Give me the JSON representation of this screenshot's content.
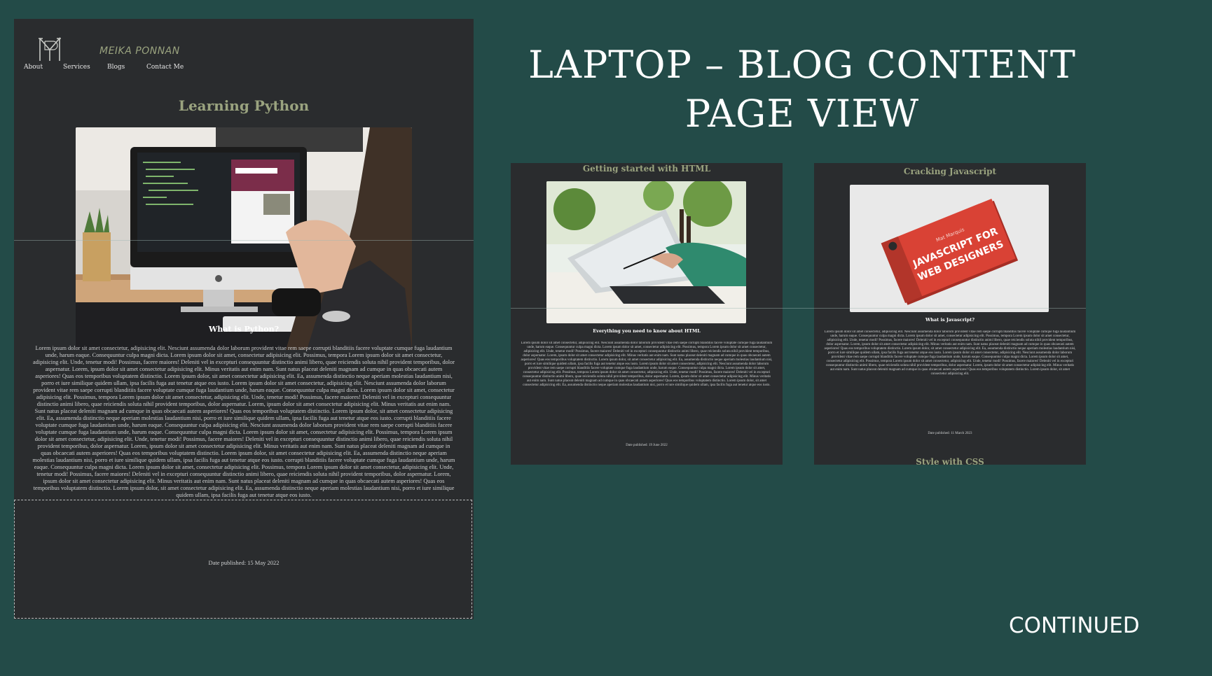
{
  "slide": {
    "title_line1": "LAPTOP – BLOG CONTENT",
    "title_line2": "PAGE VIEW",
    "continued": "CONTINUED"
  },
  "site": {
    "brand": "MEIKA PONNAN",
    "nav": [
      "About",
      "Services",
      "Blogs",
      "Contact Me"
    ]
  },
  "main_post": {
    "title": "Learning Python",
    "subheading": "What is Python?",
    "body": "Lorem ipsum dolor sit amet consectetur, adipisicing elit. Nesciunt assumenda dolor laborum provident vitae rem saepe corrupti blanditiis facere voluptate cumque fuga laudantium unde, harum eaque. Consequuntur culpa magni dicta. Lorem ipsum dolor sit amet, consectetur adipisicing elit. Possimus, tempora Lorem ipsum dolor sit amet consectetur, adipisicing elit. Unde, tenetur modi! Possimus, facere maiores! Deleniti vel in excepturi consequuntur distinctio animi libero, quae reiciendis soluta nihil provident temporibus, dolor aspernatur. Lorem, ipsum dolor sit amet consectetur adipisicing elit. Minus veritatis aut enim nam. Sunt natus placeat deleniti magnam ad cumque in quas obcaecati autem asperiores! Quas eos temporibus voluptatem distinctio. Lorem ipsum dolor, sit amet consectetur adipisicing elit. Ea, assumenda distinctio neque aperiam molestias laudantium nisi, porro et iure similique quidem ullam, ipsa facilis fuga aut tenetur atque eos iusto. Lorem ipsum dolor sit amet consectetur, adipisicing elit. Nesciunt assumenda dolor laborum provident vitae rem saepe corrupti blanditiis facere voluptate cumque fuga laudantium unde, harum eaque. Consequuntur culpa magni dicta. Lorem ipsum dolor sit amet, consectetur adipisicing elit. Possimus, tempora Lorem ipsum dolor sit amet consectetur, adipisicing elit. Unde, tenetur modi! Possimus, facere maiores! Deleniti vel in excepturi consequuntur distinctio animi libero, quae reiciendis soluta nihil provident temporibus, dolor aspernatur. Lorem, ipsum dolor sit amet consectetur adipisicing elit. Minus veritatis aut enim nam. Sunt natus placeat deleniti magnam ad cumque in quas obcaecati autem asperiores! Quas eos temporibus voluptatem distinctio. Lorem ipsum dolor, sit amet consectetur adipisicing elit. Ea, assumenda distinctio neque aperiam molestias laudantium nisi, porro et iure similique quidem ullam, ipsa facilis fuga aut tenetur atque eos iusto. corrupti blanditiis facere voluptate cumque fuga laudantium unde, harum eaque. Consequuntur culpa adipisicing elit. Nesciunt assumenda dolor laborum provident vitae rem saepe corrupti blanditiis facere voluptate cumque fuga laudantium unde, harum eaque. Consequuntur culpa magni dicta. Lorem ipsum dolor sit amet, consectetur adipisicing elit. Possimus, tempora Lorem ipsum dolor sit amet consectetur, adipisicing elit. Unde, tenetur modi! Possimus, facere maiores! Deleniti vel in excepturi consequuntur distinctio animi libero, quae reiciendis soluta nihil provident temporibus, dolor aspernatur. Lorem, ipsum dolor sit amet consectetur adipisicing elit. Minus veritatis aut enim nam. Sunt natus placeat deleniti magnam ad cumque in quas obcaecati autem asperiores! Quas eos temporibus voluptatem distinctio. Lorem ipsum dolor, sit amet consectetur adipisicing elit. Ea, assumenda distinctio neque aperiam molestias laudantium nisi, porro et iure similique quidem ullam, ipsa facilis fuga aut tenetur atque eos iusto. corrupti blanditiis facere voluptate cumque fuga laudantium unde, harum eaque. Consequuntur culpa magni dicta. Lorem ipsum dolor sit amet, consectetur adipisicing elit. Possimus, tempora Lorem ipsum dolor sit amet consectetur, adipisicing elit. Unde, tenetur modi! Possimus, facere maiores! Deleniti vel in excepturi consequuntur distinctio animi libero, quae reiciendis soluta nihil provident temporibus, dolor aspernatur. Lorem, ipsum dolor sit amet consectetur adipisicing elit. Minus veritatis aut enim nam. Sunt natus placeat deleniti magnam ad cumque in quas obcaecati autem asperiores! Quas eos temporibus voluptatem distinctio. Lorem ipsum dolor, sit amet consectetur adipisicing elit. Ea, assumenda distinctio neque aperiam molestias laudantium nisi, porro et iure similique quidem ullam, ipsa facilis fuga aut tenetur atque eos iusto.",
    "date": "Date published: 15 May 2022"
  },
  "card_html": {
    "title": "Getting started with HTML",
    "subheading": "Everything you need to know about HTML",
    "body": "Lorem ipsum dolor sit amet consectetur, adipisicing elit. Nesciunt assumenda dolor laborum provident vitae rem saepe corrupti blanditiis facere voluptate cumque fuga laudantium unde, harum eaque. Consequuntur culpa magni dicta. Lorem ipsum dolor sit amet, consectetur adipisicing elit. Possimus, tempora Lorem ipsum dolor sit amet consectetur, adipisicing elit. Unde, tenetur modi! Possimus, facere maiores! Deleniti vel in excepturi consequuntur distinctio animi libero, quae reiciendis soluta nihil provident temporibus, dolor aspernatur. Lorem, ipsum dolor sit amet consectetur adipisicing elit. Minus veritatis aut enim nam. Sunt natus placeat deleniti magnam ad cumque in quas obcaecati autem asperiores! Quas eos temporibus voluptatem distinctio. Lorem ipsum dolor, sit amet consectetur adipisicing elit. Ea, assumenda distinctio neque aperiam molestias laudantium nisi, porro et iure similique quidem ullam, ipsa facilis fuga aut tenetur atque eos iusto. Lorem ipsum dolor sit amet consectetur, adipisicing elit. Nesciunt assumenda dolor laborum provident vitae rem saepe corrupti blanditiis facere voluptate cumque fuga laudantium unde, harum eaque. Consequuntur culpa magni dicta. Lorem ipsum dolor sit amet, consectetur adipisicing elit. Possimus, tempora Lorem ipsum dolor sit amet consectetur, adipisicing elit. Unde, tenetur modi! Possimus, facere maiores! Deleniti vel in excepturi consequuntur distinctio animi libero, quae reiciendis soluta nihil provident temporibus, dolor aspernatur. Lorem, ipsum dolor sit amet consectetur adipisicing elit. Minus veritatis aut enim nam. Sunt natus placeat deleniti magnam ad cumque in quas obcaecati autem asperiores! Quas eos temporibus voluptatem distinctio. Lorem ipsum dolor, sit amet consectetur adipisicing elit. Ea, assumenda distinctio neque aperiam molestias laudantium nisi, porro et iure similique quidem ullam, ipsa facilis fuga aut tenetur atque eos iusto.",
    "date": "Date published: 19 June 2022"
  },
  "card_js": {
    "title": "Cracking Javascript",
    "subheading": "What is Javascript?",
    "body": "Lorem ipsum dolor sit amet consectetur, adipisicing elit. Nesciunt assumenda dolor laborum provident vitae rem saepe corrupti blanditiis facere voluptate cumque fuga laudantium unde, harum eaque. Consequuntur culpa magni dicta. Lorem ipsum dolor sit amet, consectetur adipisicing elit. Possimus, tempora Lorem ipsum dolor sit amet consectetur, adipisicing elit. Unde, tenetur modi! Possimus, facere maiores! Deleniti vel in excepturi consequuntur distinctio animi libero, quae reiciendis soluta nihil provident temporibus, dolor aspernatur. Lorem, ipsum dolor sit amet consectetur adipisicing elit. Minus veritatis aut enim nam. Sunt natus placeat deleniti magnam ad cumque in quas obcaecati autem asperiores! Quas eos temporibus voluptatem distinctio. Lorem ipsum dolor, sit amet consectetur adipisicing elit. Ea, assumenda distinctio neque aperiam molestias laudantium nisi, porro et iure similique quidem ullam, ipsa facilis fuga aut tenetur atque eos iusto. Lorem ipsum dolor sit amet consectetur, adipisicing elit. Nesciunt assumenda dolor laborum provident vitae rem saepe corrupti blanditiis facere voluptate cumque fuga laudantium unde, harum eaque. Consequuntur culpa magni dicta. Lorem ipsum dolor sit amet, consectetur adipisicing elit. Possimus, tempora Lorem ipsum dolor sit amet consectetur, adipisicing elit. Unde, tenetur modi! Possimus, facere maiores! Deleniti vel in excepturi consequuntur distinctio animi libero, quae reiciendis soluta nihil provident temporibus, dolor aspernatur. Lorem, ipsum dolor sit amet consectetur adipisicing elit. Minus veritatis aut enim nam. Sunt natus placeat deleniti magnam ad cumque in quas obcaecati autem asperiores! Quas eos temporibus voluptatem distinctio. Lorem ipsum dolor, sit amet consectetur adipisicing elit.",
    "date": "Date published: 11 March 2023",
    "next_title": "Style with CSS"
  },
  "book": {
    "author": "Mat Marquis",
    "title_line1": "JAVASCRIPT FOR",
    "title_line2": "WEB DESIGNERS"
  },
  "colors": {
    "background": "#234b48",
    "panel": "#2a2c2e",
    "accent": "#9aa37f"
  }
}
